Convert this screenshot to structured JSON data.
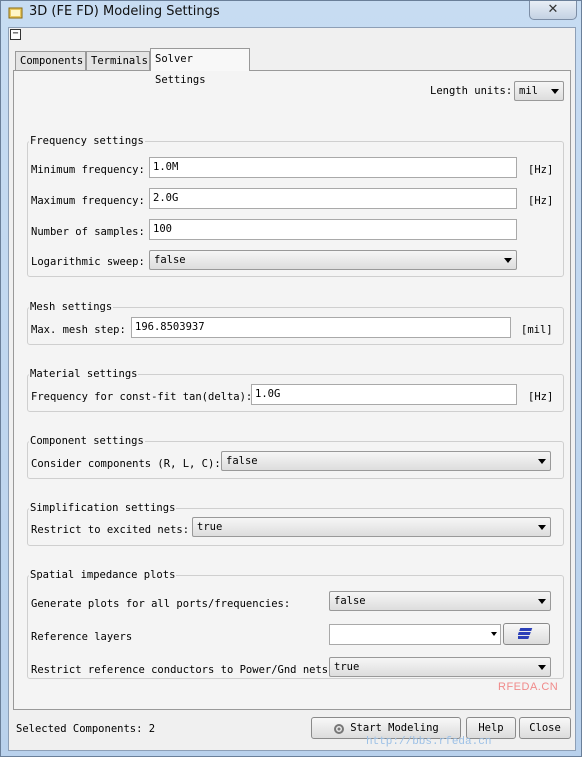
{
  "window": {
    "title": "3D (FE FD) Modeling Settings",
    "close_symbol": "✕",
    "collapse_symbol": "−"
  },
  "tabs": [
    {
      "label": "Components",
      "active": false
    },
    {
      "label": "Terminals",
      "active": false
    },
    {
      "label": "Solver Settings",
      "active": true
    }
  ],
  "length_units": {
    "label": "Length units:",
    "value": "mil"
  },
  "frequency": {
    "title": "Frequency settings",
    "min_label": "Minimum frequency:",
    "min_value": "1.0M",
    "min_unit": "[Hz]",
    "max_label": "Maximum frequency:",
    "max_value": "2.0G",
    "max_unit": "[Hz]",
    "samples_label": "Number of samples:",
    "samples_value": "100",
    "log_label": "Logarithmic sweep:",
    "log_value": "false"
  },
  "mesh": {
    "title": "Mesh settings",
    "step_label": "Max. mesh step:",
    "step_value": "196.8503937",
    "step_unit": "[mil]"
  },
  "material": {
    "title": "Material settings",
    "freq_label": "Frequency for const-fit tan(delta):",
    "freq_value": "1.0G",
    "freq_unit": "[Hz]"
  },
  "component": {
    "title": "Component settings",
    "consider_label": "Consider components (R, L, C):",
    "consider_value": "false"
  },
  "simplification": {
    "title": "Simplification settings",
    "restrict_label": "Restrict to excited nets:",
    "restrict_value": "true"
  },
  "spatial": {
    "title": "Spatial impedance plots",
    "generate_label": "Generate plots for all ports/frequencies:",
    "generate_value": "false",
    "ref_layers_label": "Reference layers",
    "ref_layers_value": "",
    "restrict_ref_label": "Restrict reference conductors to Power/Gnd nets:",
    "restrict_ref_value": "true"
  },
  "footer": {
    "selected_text": "Selected Components: 2",
    "start_label": "Start Modeling",
    "help_label": "Help",
    "close_label": "Close"
  },
  "watermark": {
    "line1": "RFEDA.CN",
    "line2": "http://bbs.rfeda.cn"
  },
  "colors": {
    "title_bg": "#c7dcf2",
    "panel_bg": "#f4f4f4",
    "layers_icon": "#2b3fb8"
  }
}
